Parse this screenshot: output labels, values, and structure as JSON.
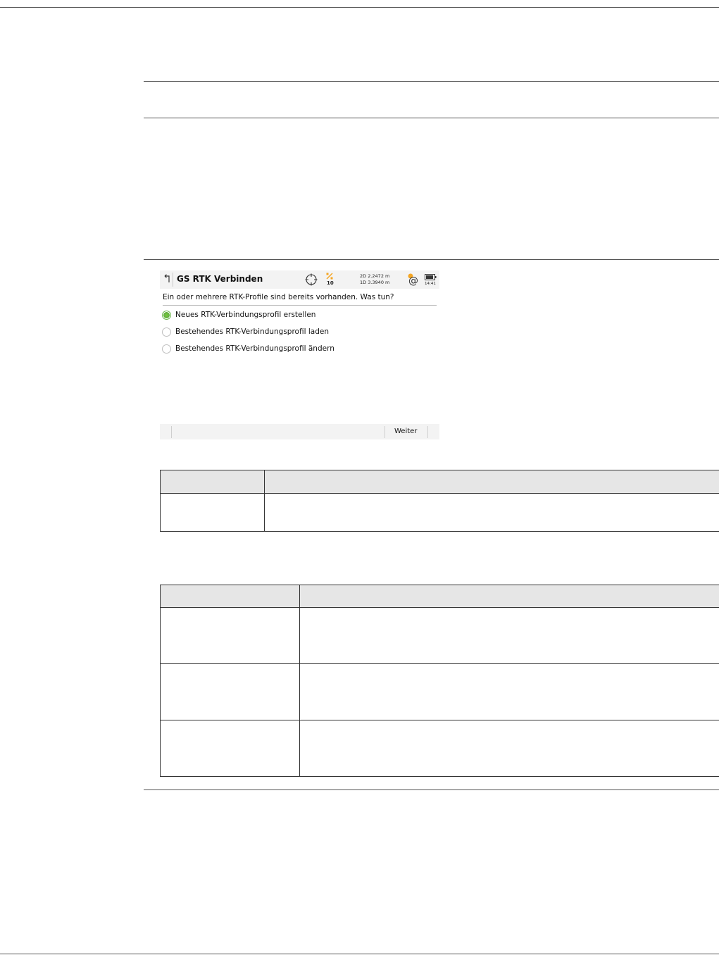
{
  "screen": {
    "title": "GS RTK Verbinden",
    "satellite_count": "10",
    "accuracy_2d": "2D 2.2472 m",
    "accuracy_1d": "1D 3.3940 m",
    "time": "14:41",
    "question": "Ein oder mehrere RTK-Profile sind bereits vorhanden. Was tun?",
    "options": [
      {
        "label": "Neues RTK-Verbindungsprofil erstellen",
        "selected": true
      },
      {
        "label": "Bestehendes RTK-Verbindungsprofil laden",
        "selected": false
      },
      {
        "label": "Bestehendes RTK-Verbindungsprofil ändern",
        "selected": false
      }
    ],
    "softkey_next": "Weiter",
    "icons": [
      "back-arrow-icon",
      "crosshair-icon",
      "satellite-icon",
      "network-icon",
      "battery-icon"
    ],
    "colors": {
      "selected_radio": "#6bb84a",
      "titlebar_bg": "#f3f3f3",
      "satellite_icon": "#f5a623"
    }
  },
  "table1": {
    "rows": [
      [
        "",
        ""
      ],
      [
        "",
        ""
      ]
    ]
  },
  "table2": {
    "rows": [
      [
        "",
        ""
      ],
      [
        "",
        ""
      ],
      [
        "",
        ""
      ],
      [
        "",
        ""
      ]
    ]
  }
}
